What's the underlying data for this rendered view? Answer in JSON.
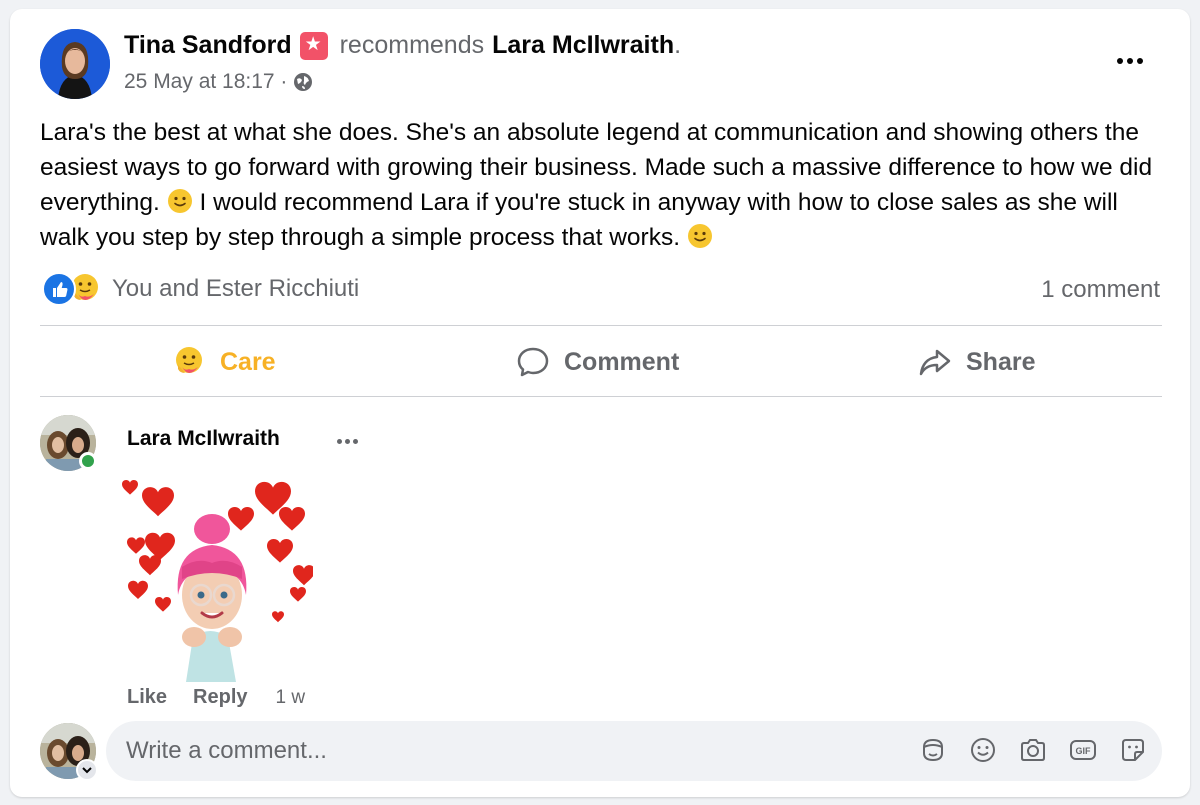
{
  "post": {
    "author": "Tina Sandford",
    "verb": "recommends",
    "target": "Lara McIlwraith",
    "period": ".",
    "timestamp": "25 May at 18:17 ·",
    "body_part1": "Lara's the best at what she does. She's an absolute legend at communication and showing others the easiest ways to go forward with growing their business. Made such a massive difference to how we did everything. ",
    "body_part2": " I would recommend Lara if you're stuck in anyway with how to close sales as she will walk you step by step through a simple process that works. "
  },
  "reactions": {
    "summary": "You and Ester Ricchiuti",
    "comment_count": "1 comment"
  },
  "actions": {
    "care": "Care",
    "comment": "Comment",
    "share": "Share"
  },
  "comment": {
    "author": "Lara McIlwraith",
    "like": "Like",
    "reply": "Reply",
    "time": "1 w"
  },
  "composer": {
    "placeholder": "Write a comment..."
  },
  "icons": {
    "badge": "recommendation-star-icon",
    "globe": "globe-icon",
    "like_reaction": "like-reaction-icon",
    "care_reaction": "care-reaction-icon",
    "comment": "comment-bubble-icon",
    "share": "share-arrow-icon",
    "composer": [
      "avatar-sticker-icon",
      "emoji-icon",
      "camera-icon",
      "gif-icon",
      "sticker-icon"
    ]
  },
  "colors": {
    "care_accent": "#f7b125",
    "like_blue": "#1b74e4",
    "badge_red": "#f25268",
    "online_green": "#31a24c",
    "secondary_text": "#65676b"
  }
}
